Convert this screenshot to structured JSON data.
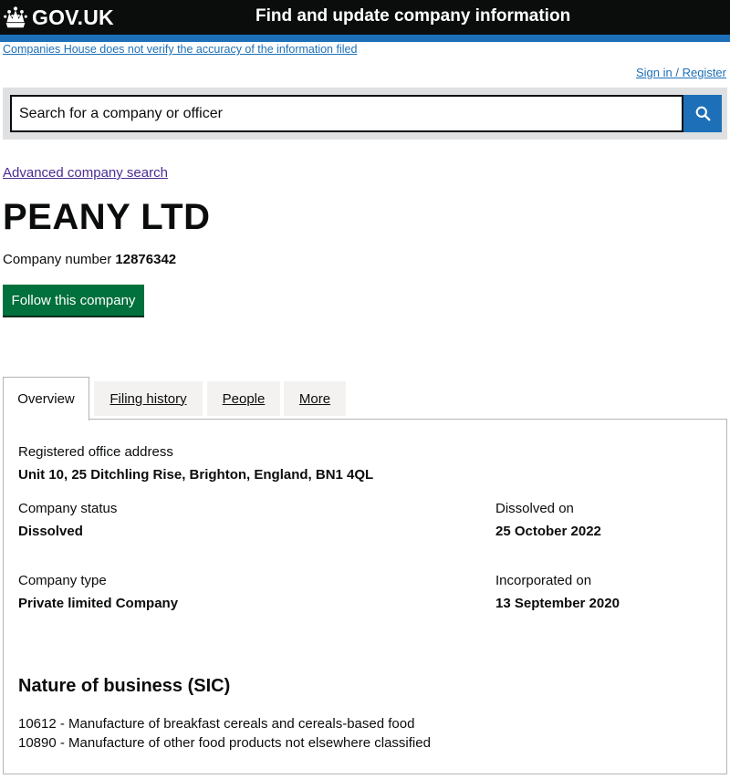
{
  "header": {
    "logo_text": "GOV.UK",
    "service_name": "Find and update company information"
  },
  "disclaimer": "Companies House does not verify the accuracy of the information filed",
  "signin": "Sign in / Register",
  "search": {
    "placeholder": "Search for a company or officer",
    "button_icon": "search-icon"
  },
  "advanced_search": "Advanced company search",
  "company": {
    "name": "PEANY LTD",
    "number_label": "Company number",
    "number": "12876342",
    "follow_button": "Follow this company"
  },
  "tabs": [
    {
      "label": "Overview",
      "active": true
    },
    {
      "label": "Filing history",
      "active": false
    },
    {
      "label": "People",
      "active": false
    },
    {
      "label": "More",
      "active": false
    }
  ],
  "overview": {
    "address_label": "Registered office address",
    "address": "Unit 10, 25 Ditchling Rise, Brighton, England, BN1 4QL",
    "status_label": "Company status",
    "status": "Dissolved",
    "dissolved_label": "Dissolved on",
    "dissolved": "25 October 2022",
    "type_label": "Company type",
    "type": "Private limited Company",
    "incorporated_label": "Incorporated on",
    "incorporated": "13 September 2020",
    "sic_title": "Nature of business (SIC)",
    "sic_codes": [
      "10612 - Manufacture of breakfast cereals and cereals-based food",
      "10890 - Manufacture of other food products not elsewhere classified"
    ]
  },
  "colors": {
    "header_bg": "#0b0c0c",
    "brand_blue": "#1d70b8",
    "follow_green": "#00703c",
    "visited_link": "#4c2c92"
  }
}
